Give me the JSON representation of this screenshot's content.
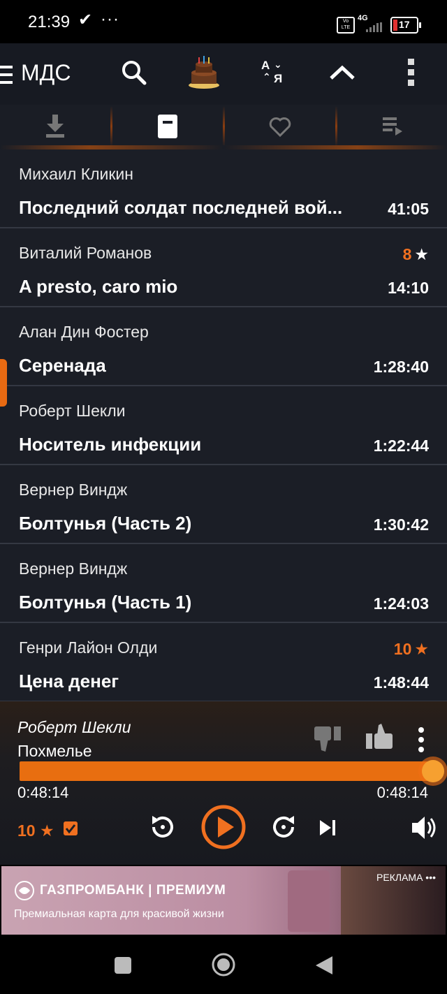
{
  "status_bar": {
    "time": "21:39",
    "check_icon": "✔",
    "more": "···",
    "volte": "Vo LTE",
    "network": "4G",
    "battery": "17"
  },
  "app_bar": {
    "title": "МДС",
    "sort_label_top": "A",
    "sort_label_bottom": "Я"
  },
  "tabs": [
    {
      "name": "downloads",
      "icon": "download-icon"
    },
    {
      "name": "current",
      "icon": "document-icon"
    },
    {
      "name": "favorites",
      "icon": "heart-icon"
    },
    {
      "name": "queue",
      "icon": "playlist-icon"
    }
  ],
  "items": [
    {
      "author": "Михаил Кликин",
      "title": "Последний солдат последней вой...",
      "duration": "41:05",
      "rating": ""
    },
    {
      "author": "Виталий Романов",
      "title": "A presto, caro mio",
      "duration": "14:10",
      "rating": "8"
    },
    {
      "author": "Алан Дин Фостер",
      "title": "Серенада",
      "duration": "1:28:40",
      "rating": ""
    },
    {
      "author": "Роберт Шекли",
      "title": "Носитель инфекции",
      "duration": "1:22:44",
      "rating": ""
    },
    {
      "author": "Вернер Виндж",
      "title": "Болтунья (Часть 2)",
      "duration": "1:30:42",
      "rating": ""
    },
    {
      "author": "Вернер Виндж",
      "title": "Болтунья (Часть 1)",
      "duration": "1:24:03",
      "rating": ""
    },
    {
      "author": "Генри Лайон Олди",
      "title": "Цена денег",
      "duration": "1:48:44",
      "rating": "10"
    }
  ],
  "player": {
    "author": "Роберт Шекли",
    "title": "Похмелье",
    "elapsed": "0:48:14",
    "total": "0:48:14",
    "progress": 1.0,
    "rating": "10",
    "star": "★"
  },
  "ad": {
    "brand": "ГАЗПРОМБАНК | ПРЕМИУМ",
    "tagline": "Премиальная карта для красивой жизни",
    "label": "РЕКЛАМА •••"
  },
  "colors": {
    "accent": "#e86e10",
    "list_bg": "#1b1e26",
    "header_bg": "#171a22"
  }
}
